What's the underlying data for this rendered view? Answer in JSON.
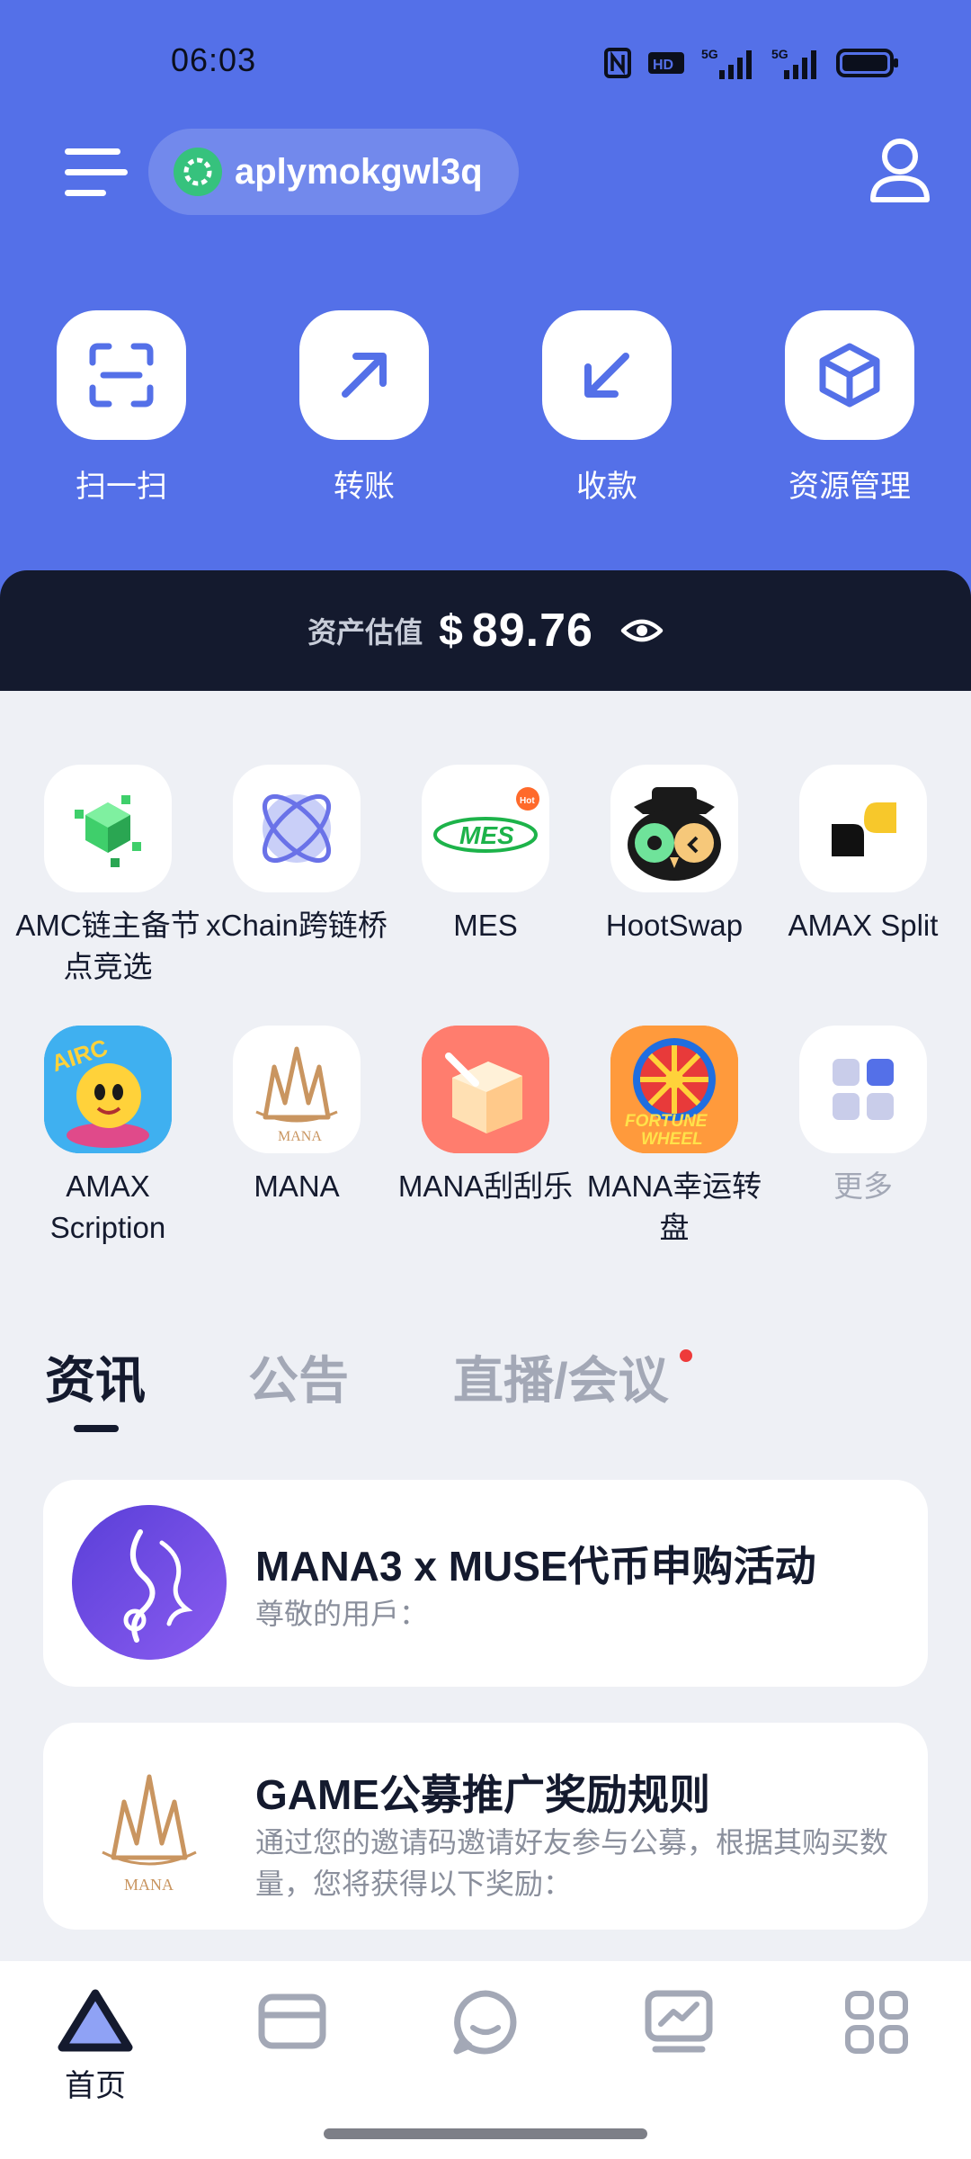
{
  "status_bar": {
    "time": "06:03",
    "icons": [
      "nfc-icon",
      "hd-icon",
      "5g-signal-icon",
      "5g-signal-icon",
      "battery-icon"
    ],
    "network_label_1": "5G",
    "network_label_2": "5G"
  },
  "header": {
    "account_name": "aplymokgwl3q",
    "menu_icon": "menu-icon",
    "user_icon": "user-icon"
  },
  "quick_actions": [
    {
      "label": "扫一扫",
      "icon": "scan-icon"
    },
    {
      "label": "转账",
      "icon": "arrow-up-right-icon"
    },
    {
      "label": "收款",
      "icon": "arrow-down-left-icon"
    },
    {
      "label": "资源管理",
      "icon": "cube-icon"
    }
  ],
  "assets": {
    "label": "资产估值",
    "currency": "$",
    "value": "89.76",
    "visibility_icon": "eye-icon"
  },
  "apps": [
    {
      "label": "AMC链主备节点竞选",
      "icon": "amc-icon"
    },
    {
      "label": "xChain跨链桥",
      "icon": "xchain-icon"
    },
    {
      "label": "MES",
      "icon": "mes-icon",
      "badge": "hot"
    },
    {
      "label": "HootSwap",
      "icon": "hootswap-icon"
    },
    {
      "label": "AMAX Split",
      "icon": "amax-split-icon"
    },
    {
      "label": "AMAX Scription",
      "icon": "airc-icon"
    },
    {
      "label": "MANA",
      "icon": "mana-icon"
    },
    {
      "label": "MANA刮刮乐",
      "icon": "scratch-card-icon"
    },
    {
      "label": "MANA幸运转盘",
      "icon": "fortune-wheel-icon"
    },
    {
      "label": "更多",
      "icon": "grid-more-icon"
    }
  ],
  "app_icon_text": {
    "mes": "MES",
    "hot": "Hot",
    "airc": "AIRC",
    "mana": "MANA",
    "fortune_1": "FORTUNE",
    "fortune_2": "WHEEL"
  },
  "tabs": [
    {
      "label": "资讯",
      "active": true
    },
    {
      "label": "公告",
      "active": false
    },
    {
      "label": "直播/会议",
      "active": false,
      "has_dot": true
    }
  ],
  "news": [
    {
      "title": "MANA3 x MUSE代币申购活动",
      "desc": "尊敬的用戶："
    },
    {
      "title": "GAME公募推广奖励规则",
      "desc": "通过您的邀请码邀请好友参与公募，根据其购买数量，您将获得以下奖励："
    }
  ],
  "bottom_nav": [
    {
      "label": "首页",
      "icon": "home-triangle-icon",
      "active": true
    },
    {
      "label": "",
      "icon": "wallet-icon"
    },
    {
      "label": "",
      "icon": "chat-icon"
    },
    {
      "label": "",
      "icon": "market-chart-icon"
    },
    {
      "label": "",
      "icon": "apps-grid-icon"
    }
  ],
  "colors": {
    "brand_blue": "#5470e8",
    "dark_navy": "#141a2e",
    "page_bg": "#eef0f5",
    "muted_text": "#a3a8b6",
    "notification_red": "#ee3a3a"
  }
}
